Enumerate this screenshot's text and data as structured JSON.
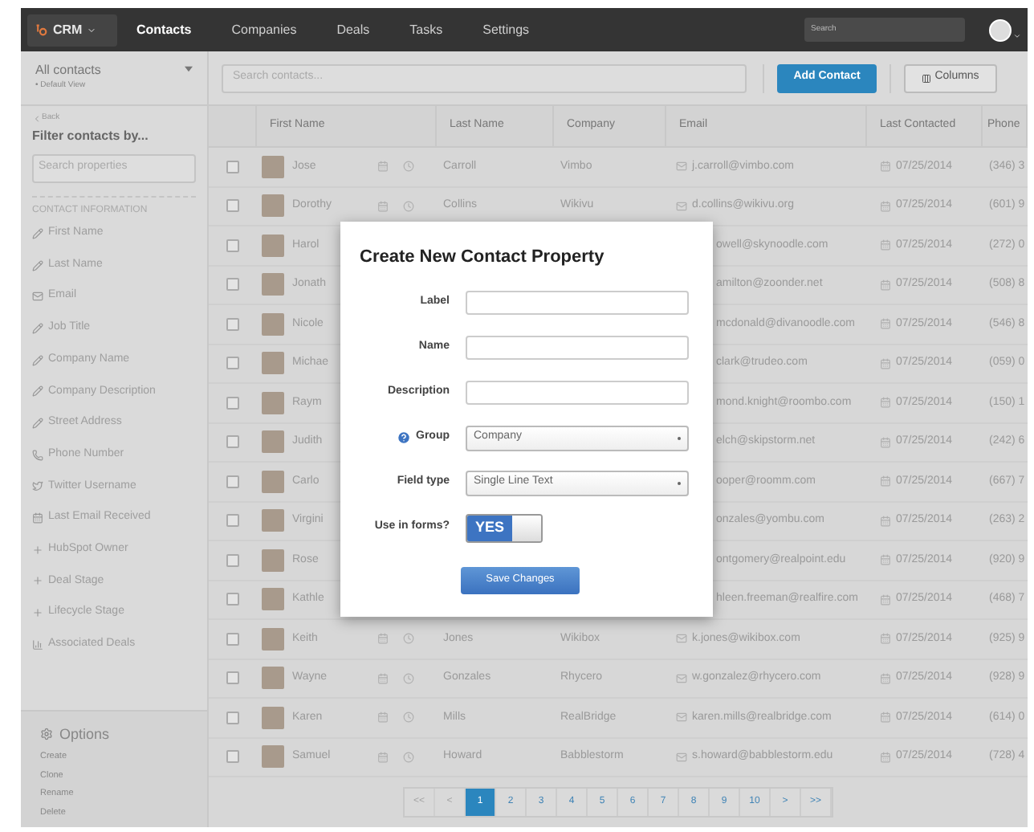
{
  "topbar": {
    "brand": "CRM",
    "nav": [
      {
        "label": "Contacts",
        "selected": true
      },
      {
        "label": "Companies",
        "selected": false
      },
      {
        "label": "Deals",
        "selected": false
      },
      {
        "label": "Tasks",
        "selected": false
      },
      {
        "label": "Settings",
        "selected": false
      }
    ],
    "search": {
      "placeholder": "Search"
    }
  },
  "sidebar": {
    "view_title": "All contacts",
    "view_subtitle": "• Default View",
    "back": "Back",
    "filter_title": "Filter contacts by...",
    "search": {
      "placeholder": "Search properties"
    },
    "section": "CONTACT INFORMATION",
    "properties": [
      {
        "label": "First Name",
        "kind": "edit"
      },
      {
        "label": "Last Name",
        "kind": "edit"
      },
      {
        "label": "Email",
        "kind": "mail"
      },
      {
        "label": "Job Title",
        "kind": "edit"
      },
      {
        "label": "Company Name",
        "kind": "edit"
      },
      {
        "label": "Company Description",
        "kind": "edit"
      },
      {
        "label": "Street Address",
        "kind": "edit"
      },
      {
        "label": "Phone Number",
        "kind": "phone"
      },
      {
        "label": "Twitter Username",
        "kind": "bird"
      },
      {
        "label": "Last Email Received",
        "kind": "calendar"
      },
      {
        "label": "HubSpot Owner",
        "kind": "plus"
      },
      {
        "label": "Deal Stage",
        "kind": "plus"
      },
      {
        "label": "Lifecycle Stage",
        "kind": "plus"
      },
      {
        "label": "Associated Deals",
        "kind": "chart"
      }
    ],
    "options_title": "Options",
    "options": [
      "Create",
      "Clone",
      "Rename",
      "Delete"
    ]
  },
  "toolbar": {
    "search": {
      "placeholder": "Search contacts..."
    },
    "add_button": "Add Contact",
    "columns_button": "Columns"
  },
  "table": {
    "columns": [
      "First Name",
      "Last Name",
      "Company",
      "Email",
      "Last Contacted",
      "Phone"
    ],
    "rows": [
      {
        "kind": "full",
        "checked": false,
        "first_name": "Jose",
        "last_name": "Carroll",
        "company": "Vimbo",
        "email": "j.carroll@vimbo.com",
        "last_contacted": "07/25/2014",
        "phone": "(346) 3"
      },
      {
        "kind": "full",
        "checked": false,
        "first_name": "Dorothy",
        "last_name": "Collins",
        "company": "Wikivu",
        "email": "d.collins@wikivu.org",
        "last_contacted": "07/25/2014",
        "phone": "(601) 9"
      },
      {
        "kind": "covered",
        "checked": false,
        "first_name": "Harol",
        "email": "owell@skynoodle.com",
        "last_contacted": "07/25/2014",
        "phone": "(272) 0"
      },
      {
        "kind": "covered",
        "checked": false,
        "first_name": "Jonath",
        "email": "amilton@zoonder.net",
        "last_contacted": "07/25/2014",
        "phone": "(508) 8"
      },
      {
        "kind": "covered",
        "checked": false,
        "first_name": "Nicole",
        "email": "mcdonald@divanoodle.com",
        "last_contacted": "07/25/2014",
        "phone": "(546) 8"
      },
      {
        "kind": "covered",
        "checked": false,
        "first_name": "Michae",
        "email": "clark@trudeo.com",
        "last_contacted": "07/25/2014",
        "phone": "(059) 0"
      },
      {
        "kind": "covered",
        "checked": false,
        "first_name": "Raym",
        "email": "mond.knight@roombo.com",
        "last_contacted": "07/25/2014",
        "phone": "(150) 1"
      },
      {
        "kind": "covered",
        "checked": false,
        "first_name": "Judith",
        "email": "elch@skipstorm.net",
        "last_contacted": "07/25/2014",
        "phone": "(242) 6"
      },
      {
        "kind": "covered",
        "checked": false,
        "first_name": "Carlo",
        "email": "ooper@roomm.com",
        "last_contacted": "07/25/2014",
        "phone": "(667) 7"
      },
      {
        "kind": "covered",
        "checked": false,
        "first_name": "Virgini",
        "email": "onzales@yombu.com",
        "last_contacted": "07/25/2014",
        "phone": "(263) 2"
      },
      {
        "kind": "covered",
        "checked": false,
        "first_name": "Rose",
        "email": "ontgomery@realpoint.edu",
        "last_contacted": "07/25/2014",
        "phone": "(920) 9"
      },
      {
        "kind": "covered",
        "checked": false,
        "first_name": "Kathle",
        "email": "hleen.freeman@realfire.com",
        "last_contacted": "07/25/2014",
        "phone": "(468) 7"
      },
      {
        "kind": "full",
        "checked": false,
        "first_name": "Keith",
        "last_name": "Jones",
        "company": "Wikibox",
        "email": "k.jones@wikibox.com",
        "last_contacted": "07/25/2014",
        "phone": "(925) 9"
      },
      {
        "kind": "full",
        "checked": false,
        "first_name": "Wayne",
        "last_name": "Gonzales",
        "company": "Rhycero",
        "email": "w.gonzalez@rhycero.com",
        "last_contacted": "07/25/2014",
        "phone": "(928) 9"
      },
      {
        "kind": "full",
        "checked": false,
        "first_name": "Karen",
        "last_name": "Mills",
        "company": "RealBridge",
        "email": "karen.mills@realbridge.com",
        "last_contacted": "07/25/2014",
        "phone": "(614) 0"
      },
      {
        "kind": "full",
        "checked": false,
        "first_name": "Samuel",
        "last_name": "Howard",
        "company": "Babblestorm",
        "email": "s.howard@babblestorm.edu",
        "last_contacted": "07/25/2014",
        "phone": "(728) 4"
      }
    ]
  },
  "pagination": [
    {
      "label": "<<",
      "selected": false,
      "disabled": true
    },
    {
      "label": "<",
      "selected": false,
      "disabled": true
    },
    {
      "label": "1",
      "selected": true,
      "disabled": false
    },
    {
      "label": "2",
      "selected": false,
      "disabled": false
    },
    {
      "label": "3",
      "selected": false,
      "disabled": false
    },
    {
      "label": "4",
      "selected": false,
      "disabled": false
    },
    {
      "label": "5",
      "selected": false,
      "disabled": false
    },
    {
      "label": "6",
      "selected": false,
      "disabled": false
    },
    {
      "label": "7",
      "selected": false,
      "disabled": false
    },
    {
      "label": "8",
      "selected": false,
      "disabled": false
    },
    {
      "label": "9",
      "selected": false,
      "disabled": false
    },
    {
      "label": "10",
      "selected": false,
      "disabled": false
    },
    {
      "label": ">",
      "selected": false,
      "disabled": false
    },
    {
      "label": ">>",
      "selected": false,
      "disabled": false
    }
  ],
  "modal": {
    "title": "Create New Contact Property",
    "fields": [
      {
        "label": "Label",
        "kind": "text"
      },
      {
        "label": "Name",
        "kind": "text"
      },
      {
        "label": "Description",
        "kind": "text"
      },
      {
        "label": "Group",
        "kind": "select",
        "value": "Company",
        "help": true
      },
      {
        "label": "Field type",
        "kind": "select",
        "value": "Single Line Text",
        "help": false
      },
      {
        "label": "Use in forms?",
        "kind": "toggle",
        "on": true,
        "on_text": "YES"
      }
    ],
    "save_button": "Save Changes"
  }
}
